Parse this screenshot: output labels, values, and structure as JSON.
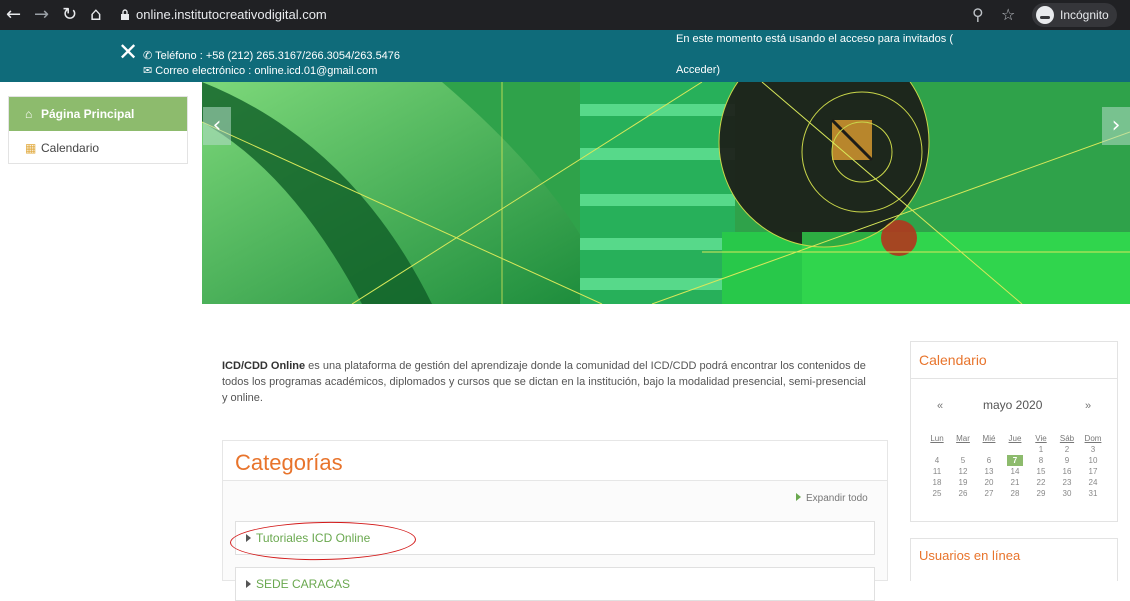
{
  "browser": {
    "url": "online.institutocreativodigital.com",
    "incognito_label": "Incógnito"
  },
  "topbar": {
    "phone": "Teléfono : +58 (212) 265.3167/266.3054/263.5476",
    "email": "Correo electrónico : online.icd.01@gmail.com",
    "guest_text": "En este momento está usando el acceso para invitados (",
    "login_link": "Acceder)"
  },
  "sidebar": {
    "items": [
      {
        "label": "Página Principal",
        "icon": "home-icon",
        "active": true
      },
      {
        "label": "Calendario",
        "icon": "calendar-icon",
        "active": false
      }
    ]
  },
  "intro": {
    "brand": "ICD/CDD Online",
    "text": " es una plataforma de gestión del aprendizaje  donde la  comunidad del ICD/CDD podrá encontrar los contenidos de todos los programas académicos, diplomados y cursos que se dictan en la institución, bajo la modalidad presencial, semi-presencial y online."
  },
  "categories": {
    "title": "Categorías",
    "expand_all": "Expandir todo",
    "items": [
      "Tutoriales ICD Online",
      "SEDE CARACAS"
    ]
  },
  "calendar": {
    "title": "Calendario",
    "prev": "«",
    "next": "»",
    "month": "mayo 2020",
    "weekdays": [
      "Lun",
      "Mar",
      "Mié",
      "Jue",
      "Vie",
      "Sáb",
      "Dom"
    ],
    "weeks": [
      [
        "",
        "",
        "",
        "",
        "1",
        "2",
        "3"
      ],
      [
        "4",
        "5",
        "6",
        "7",
        "8",
        "9",
        "10"
      ],
      [
        "11",
        "12",
        "13",
        "14",
        "15",
        "16",
        "17"
      ],
      [
        "18",
        "19",
        "20",
        "21",
        "22",
        "23",
        "24"
      ],
      [
        "25",
        "26",
        "27",
        "28",
        "29",
        "30",
        "31"
      ]
    ],
    "today": "7"
  },
  "online_users": {
    "title": "Usuarios en línea"
  }
}
